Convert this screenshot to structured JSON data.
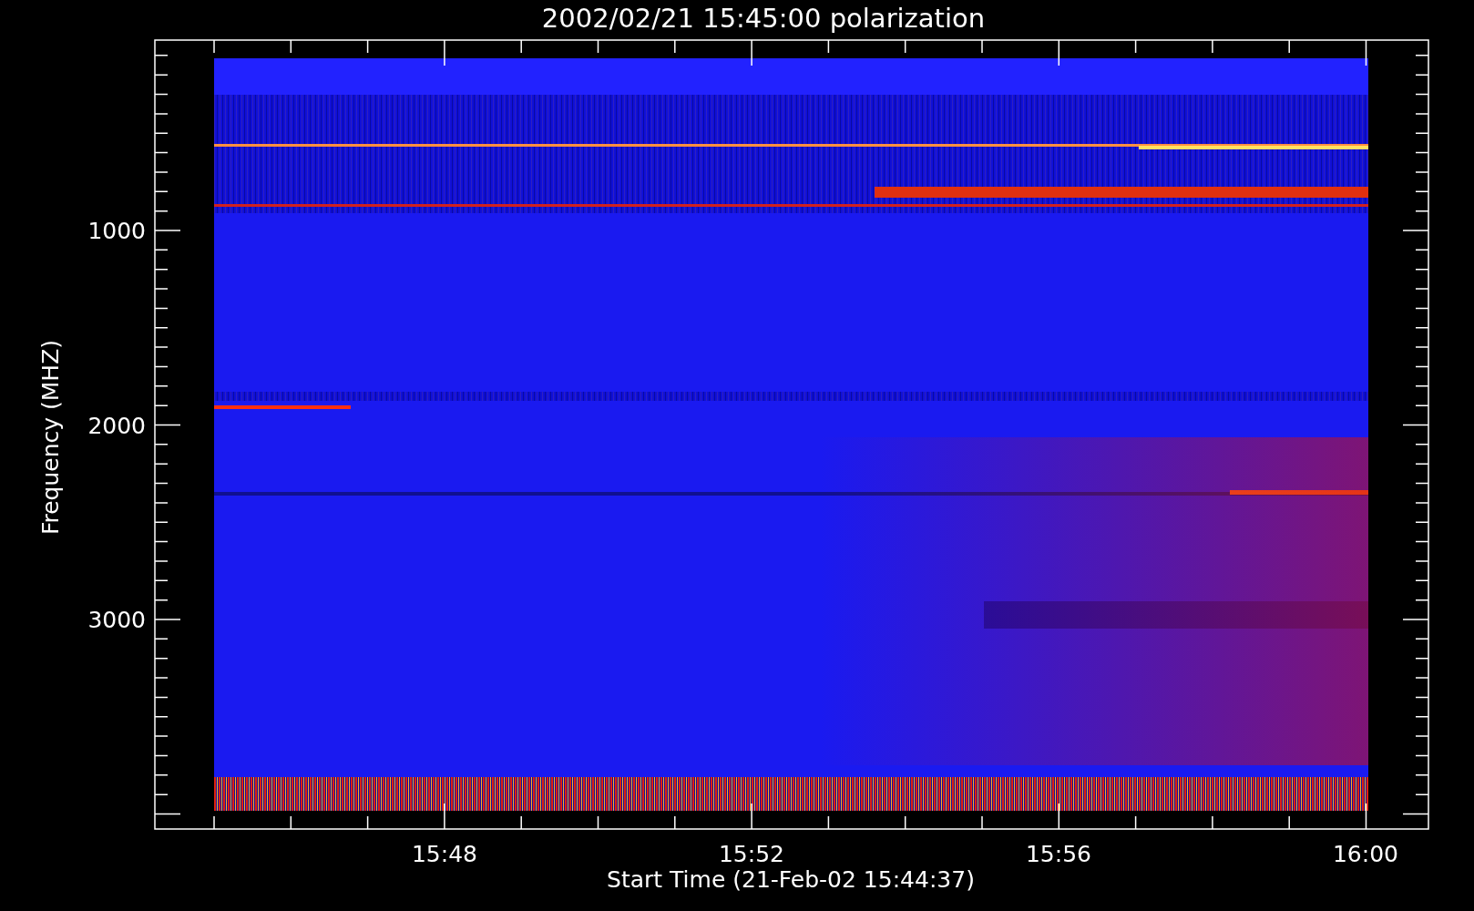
{
  "title": "2002/02/21 15:45:00 polarization",
  "chart": {
    "ylabel": "Frequency (MHZ)",
    "xlabel": "Start Time (21-Feb-02 15:44:37)",
    "yticks": [
      "1000",
      "2000",
      "3000"
    ],
    "xticks": [
      "15:48",
      "15:52",
      "15:56",
      "16:00"
    ]
  }
}
